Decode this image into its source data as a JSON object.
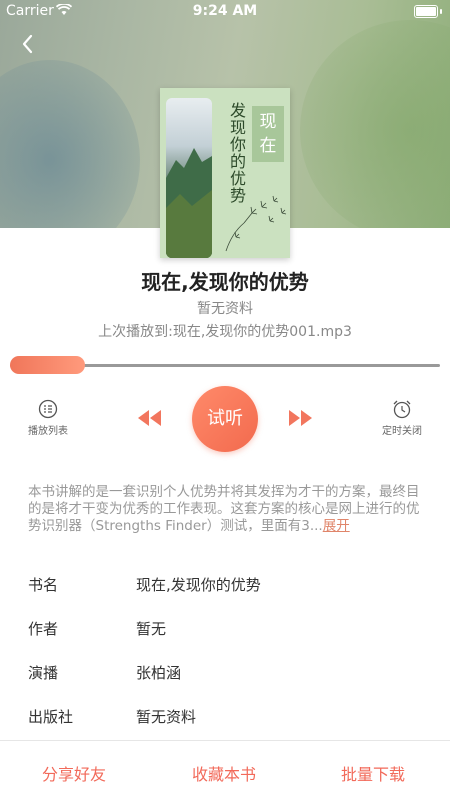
{
  "status_bar": {
    "carrier": "Carrier",
    "time": "9:24 AM"
  },
  "cover": {
    "vertical_title": "发现你的优势",
    "stamp": "现在"
  },
  "book": {
    "title": "现在,发现你的优势",
    "author_line": "暂无资料",
    "last_played": "上次播放到:现在,发现你的优势001.mp3"
  },
  "player": {
    "progress": 0.0,
    "playlist_label": "播放列表",
    "play_label": "试听",
    "timer_label": "定时关闭"
  },
  "description": {
    "text": "本书讲解的是一套识别个人优势并将其发挥为才干的方案，最终目的是将才干变为优秀的工作表现。这套方案的核心是网上进行的优势识别器（Strengths Finder）测试，里面有3...",
    "expand": "展开"
  },
  "info": [
    {
      "key": "书名",
      "value": "现在,发现你的优势"
    },
    {
      "key": "作者",
      "value": "暂无"
    },
    {
      "key": "演播",
      "value": "张柏涵"
    },
    {
      "key": "出版社",
      "value": "暂无资料"
    }
  ],
  "actions": {
    "share": "分享好友",
    "favorite": "收藏本书",
    "download": "批量下载"
  },
  "colors": {
    "accent": "#f26a4e",
    "action_text": "#f26a5a"
  }
}
